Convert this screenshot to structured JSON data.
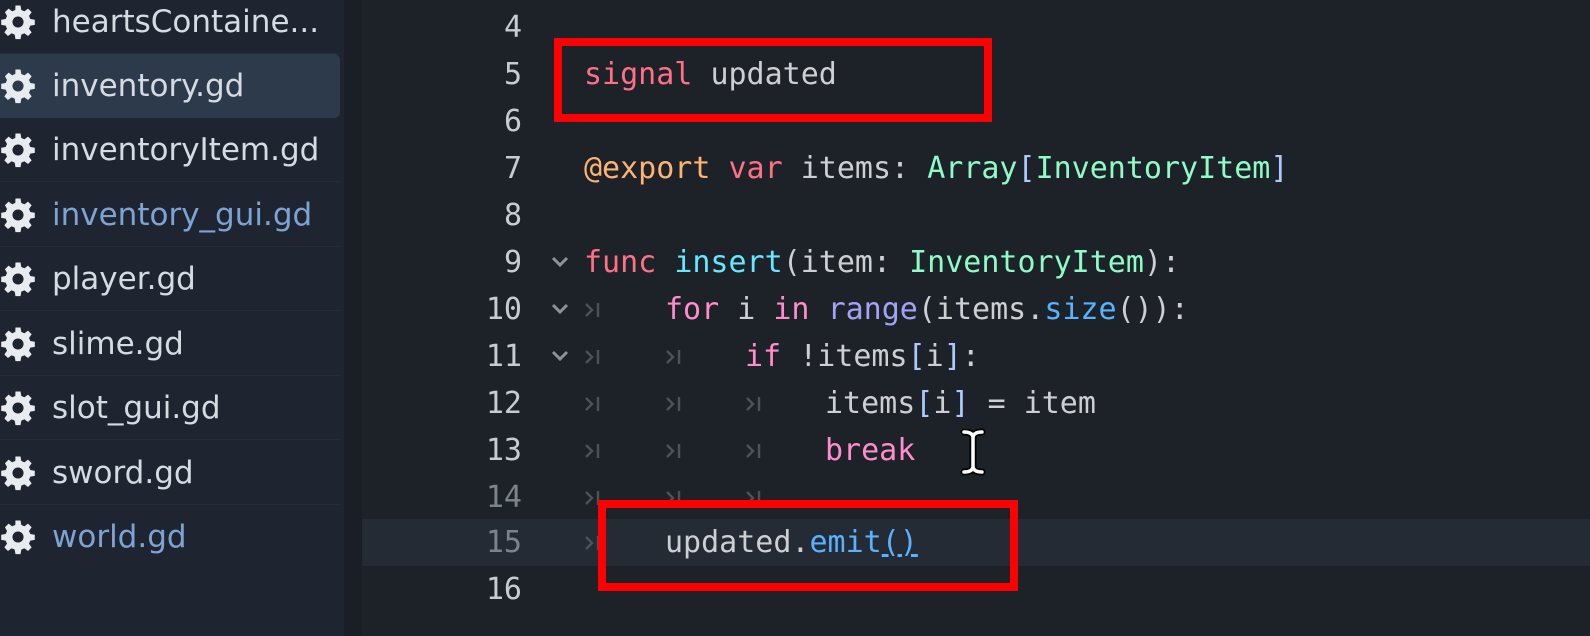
{
  "sidebar": {
    "files": [
      {
        "name": "heartsContaine...",
        "selected": false,
        "color": "#d6dbe3"
      },
      {
        "name": "inventory.gd",
        "selected": true,
        "color": "#d6dbe3"
      },
      {
        "name": "inventoryItem.gd",
        "selected": false,
        "color": "#d6dbe3"
      },
      {
        "name": "inventory_gui.gd",
        "selected": false,
        "color": "#7ca3d4"
      },
      {
        "name": "player.gd",
        "selected": false,
        "color": "#d6dbe3"
      },
      {
        "name": "slime.gd",
        "selected": false,
        "color": "#d6dbe3"
      },
      {
        "name": "slot_gui.gd",
        "selected": false,
        "color": "#d6dbe3"
      },
      {
        "name": "sword.gd",
        "selected": false,
        "color": "#d6dbe3"
      },
      {
        "name": "world.gd",
        "selected": false,
        "color": "#7ca3d4"
      }
    ],
    "file_icon": "gear-icon"
  },
  "editor": {
    "lines": [
      {
        "number": "4"
      },
      {
        "number": "5",
        "tokens": [
          "signal",
          "updated"
        ]
      },
      {
        "number": "6"
      },
      {
        "number": "7",
        "tokens": [
          "@export",
          "var",
          "items:",
          "Array",
          "[",
          "InventoryItem",
          "]"
        ]
      },
      {
        "number": "8"
      },
      {
        "number": "9",
        "tokens": [
          "func",
          "insert",
          "(item:",
          "InventoryItem",
          "):"
        ]
      },
      {
        "number": "10",
        "tokens": [
          "for",
          "i",
          "in",
          "range",
          "(items.",
          "size",
          "()):"
        ]
      },
      {
        "number": "11",
        "tokens": [
          "if",
          "!items",
          "[",
          "i",
          "]",
          ":"
        ]
      },
      {
        "number": "12",
        "tokens": [
          "items",
          "[",
          "i",
          "]",
          "=",
          "item"
        ]
      },
      {
        "number": "13",
        "tokens": [
          "break"
        ]
      },
      {
        "number": "14"
      },
      {
        "number": "15",
        "tokens": [
          "updated.",
          "emit",
          "()"
        ],
        "current": true
      },
      {
        "number": "16"
      }
    ],
    "highlight_color": "#ff0000",
    "colors": {
      "background": "#1d2229",
      "keyword": "#ff7085",
      "control_keyword": "#ff8ccc",
      "annotation": "#ffb373",
      "type": "#8ffcc5",
      "function": "#66e6ff",
      "member_call": "#57b3ff",
      "builtin": "#a3a3f5"
    }
  }
}
